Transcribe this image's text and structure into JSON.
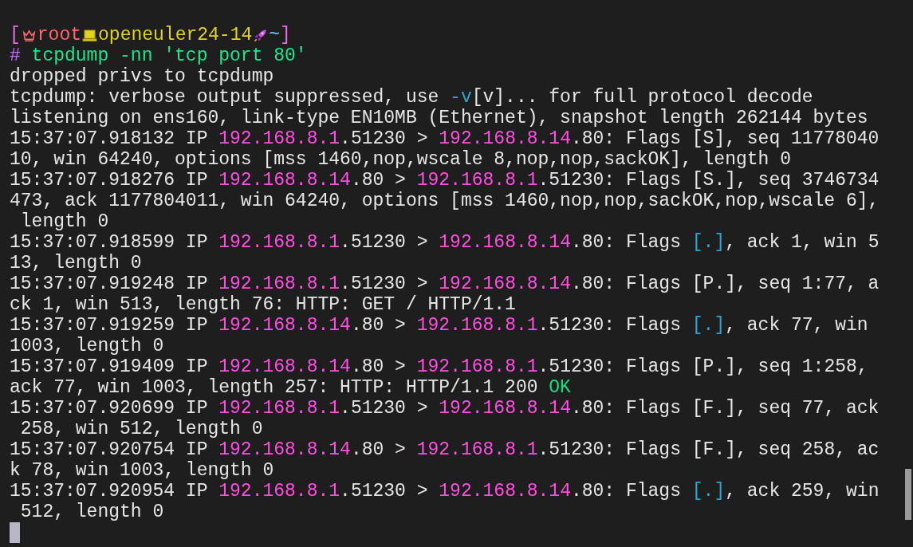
{
  "prompt": {
    "open_bracket": "[",
    "user": "root",
    "host": "openeuler24-14",
    "directory": "~",
    "close_bracket": "]"
  },
  "command": {
    "symbol": "#",
    "text": "tcpdump -nn 'tcp port 80'"
  },
  "output_lines": [
    [
      {
        "kind": "plain",
        "text": "dropped privs to tcpdump"
      }
    ],
    [
      {
        "kind": "plain",
        "text": "tcpdump: verbose output suppressed, use "
      },
      {
        "kind": "option",
        "text": "-v"
      },
      {
        "kind": "plain",
        "text": "[v]... for full protocol decode"
      }
    ],
    [
      {
        "kind": "plain",
        "text": "listening on ens160, link-type EN10MB (Ethernet), snapshot length 262144 bytes"
      }
    ],
    [
      {
        "kind": "plain",
        "text": "15:37:07.918132 IP "
      },
      {
        "kind": "ip",
        "text": "192.168.8.1"
      },
      {
        "kind": "plain",
        "text": ".51230 > "
      },
      {
        "kind": "ip",
        "text": "192.168.8.14"
      },
      {
        "kind": "plain",
        "text": ".80: Flags [S], seq 11778040"
      }
    ],
    [
      {
        "kind": "plain",
        "text": "10, win 64240, options [mss 1460,nop,wscale 8,nop,nop,sackOK], length 0"
      }
    ],
    [
      {
        "kind": "plain",
        "text": "15:37:07.918276 IP "
      },
      {
        "kind": "ip",
        "text": "192.168.8.14"
      },
      {
        "kind": "plain",
        "text": ".80 > "
      },
      {
        "kind": "ip",
        "text": "192.168.8.1"
      },
      {
        "kind": "plain",
        "text": ".51230: Flags [S.], seq 3746734"
      }
    ],
    [
      {
        "kind": "plain",
        "text": "473, ack 1177804011, win 64240, options [mss 1460,nop,nop,sackOK,nop,wscale 6],"
      }
    ],
    [
      {
        "kind": "plain",
        "text": " length 0"
      }
    ],
    [
      {
        "kind": "plain",
        "text": "15:37:07.918599 IP "
      },
      {
        "kind": "ip",
        "text": "192.168.8.1"
      },
      {
        "kind": "plain",
        "text": ".51230 > "
      },
      {
        "kind": "ip",
        "text": "192.168.8.14"
      },
      {
        "kind": "plain",
        "text": ".80: Flags "
      },
      {
        "kind": "flag",
        "text": "[.]"
      },
      {
        "kind": "plain",
        "text": ", ack 1, win 5"
      }
    ],
    [
      {
        "kind": "plain",
        "text": "13, length 0"
      }
    ],
    [
      {
        "kind": "plain",
        "text": "15:37:07.919248 IP "
      },
      {
        "kind": "ip",
        "text": "192.168.8.1"
      },
      {
        "kind": "plain",
        "text": ".51230 > "
      },
      {
        "kind": "ip",
        "text": "192.168.8.14"
      },
      {
        "kind": "plain",
        "text": ".80: Flags [P.], seq 1:77, a"
      }
    ],
    [
      {
        "kind": "plain",
        "text": "ck 1, win 513, length 76: HTTP: GET / HTTP/1.1"
      }
    ],
    [
      {
        "kind": "plain",
        "text": "15:37:07.919259 IP "
      },
      {
        "kind": "ip",
        "text": "192.168.8.14"
      },
      {
        "kind": "plain",
        "text": ".80 > "
      },
      {
        "kind": "ip",
        "text": "192.168.8.1"
      },
      {
        "kind": "plain",
        "text": ".51230: Flags "
      },
      {
        "kind": "flag",
        "text": "[.]"
      },
      {
        "kind": "plain",
        "text": ", ack 77, win"
      }
    ],
    [
      {
        "kind": "plain",
        "text": "1003, length 0"
      }
    ],
    [
      {
        "kind": "plain",
        "text": "15:37:07.919409 IP "
      },
      {
        "kind": "ip",
        "text": "192.168.8.14"
      },
      {
        "kind": "plain",
        "text": ".80 > "
      },
      {
        "kind": "ip",
        "text": "192.168.8.1"
      },
      {
        "kind": "plain",
        "text": ".51230: Flags [P.], seq 1:258,"
      }
    ],
    [
      {
        "kind": "plain",
        "text": "ack 77, win 1003, length 257: HTTP: HTTP/1.1 200 "
      },
      {
        "kind": "ok",
        "text": "OK"
      }
    ],
    [
      {
        "kind": "plain",
        "text": "15:37:07.920699 IP "
      },
      {
        "kind": "ip",
        "text": "192.168.8.1"
      },
      {
        "kind": "plain",
        "text": ".51230 > "
      },
      {
        "kind": "ip",
        "text": "192.168.8.14"
      },
      {
        "kind": "plain",
        "text": ".80: Flags [F.], seq 77, ack"
      }
    ],
    [
      {
        "kind": "plain",
        "text": " 258, win 512, length 0"
      }
    ],
    [
      {
        "kind": "plain",
        "text": "15:37:07.920754 IP "
      },
      {
        "kind": "ip",
        "text": "192.168.8.14"
      },
      {
        "kind": "plain",
        "text": ".80 > "
      },
      {
        "kind": "ip",
        "text": "192.168.8.1"
      },
      {
        "kind": "plain",
        "text": ".51230: Flags [F.], seq 258, ac"
      }
    ],
    [
      {
        "kind": "plain",
        "text": "k 78, win 1003, length 0"
      }
    ],
    [
      {
        "kind": "plain",
        "text": "15:37:07.920954 IP "
      },
      {
        "kind": "ip",
        "text": "192.168.8.1"
      },
      {
        "kind": "plain",
        "text": ".51230 > "
      },
      {
        "kind": "ip",
        "text": "192.168.8.14"
      },
      {
        "kind": "plain",
        "text": ".80: Flags "
      },
      {
        "kind": "flag",
        "text": "[.]"
      },
      {
        "kind": "plain",
        "text": ", ack 259, win"
      }
    ],
    [
      {
        "kind": "plain",
        "text": " 512, length 0"
      }
    ]
  ]
}
